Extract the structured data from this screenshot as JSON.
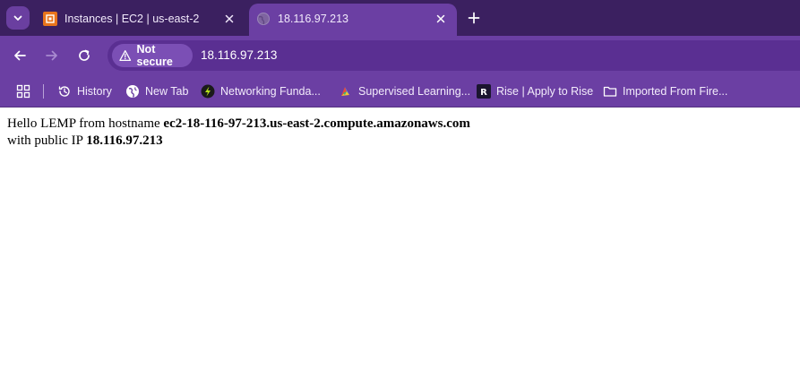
{
  "tabs": [
    {
      "title": "Instances | EC2 | us-east-2",
      "active": false,
      "favicon": "aws-ec2-icon"
    },
    {
      "title": "18.116.97.213",
      "active": true,
      "favicon": "globe-icon"
    }
  ],
  "toolbar": {
    "security_label": "Not secure",
    "url": "18.116.97.213"
  },
  "bookmarks": [
    {
      "label": "History",
      "icon": "history-icon"
    },
    {
      "label": "New Tab",
      "icon": "globe-icon"
    },
    {
      "label": "Networking Funda...",
      "icon": "lightning-icon"
    },
    {
      "label": "Supervised Learning...",
      "icon": "colorful-icon"
    },
    {
      "label": "Rise | Apply to Rise",
      "icon": "rise-logo-icon"
    },
    {
      "label": "Imported From Fire...",
      "icon": "folder-icon"
    }
  ],
  "page": {
    "line1_prefix": "Hello LEMP from hostname",
    "hostname": "ec2-18-116-97-213.us-east-2.compute.amazonaws.com",
    "line2_prefix": "with public IP",
    "public_ip": "18.116.97.213"
  },
  "colors": {
    "tabstrip": "#3b2060",
    "toolbar": "#6b3fa3",
    "omnibox": "#5a2f92"
  }
}
